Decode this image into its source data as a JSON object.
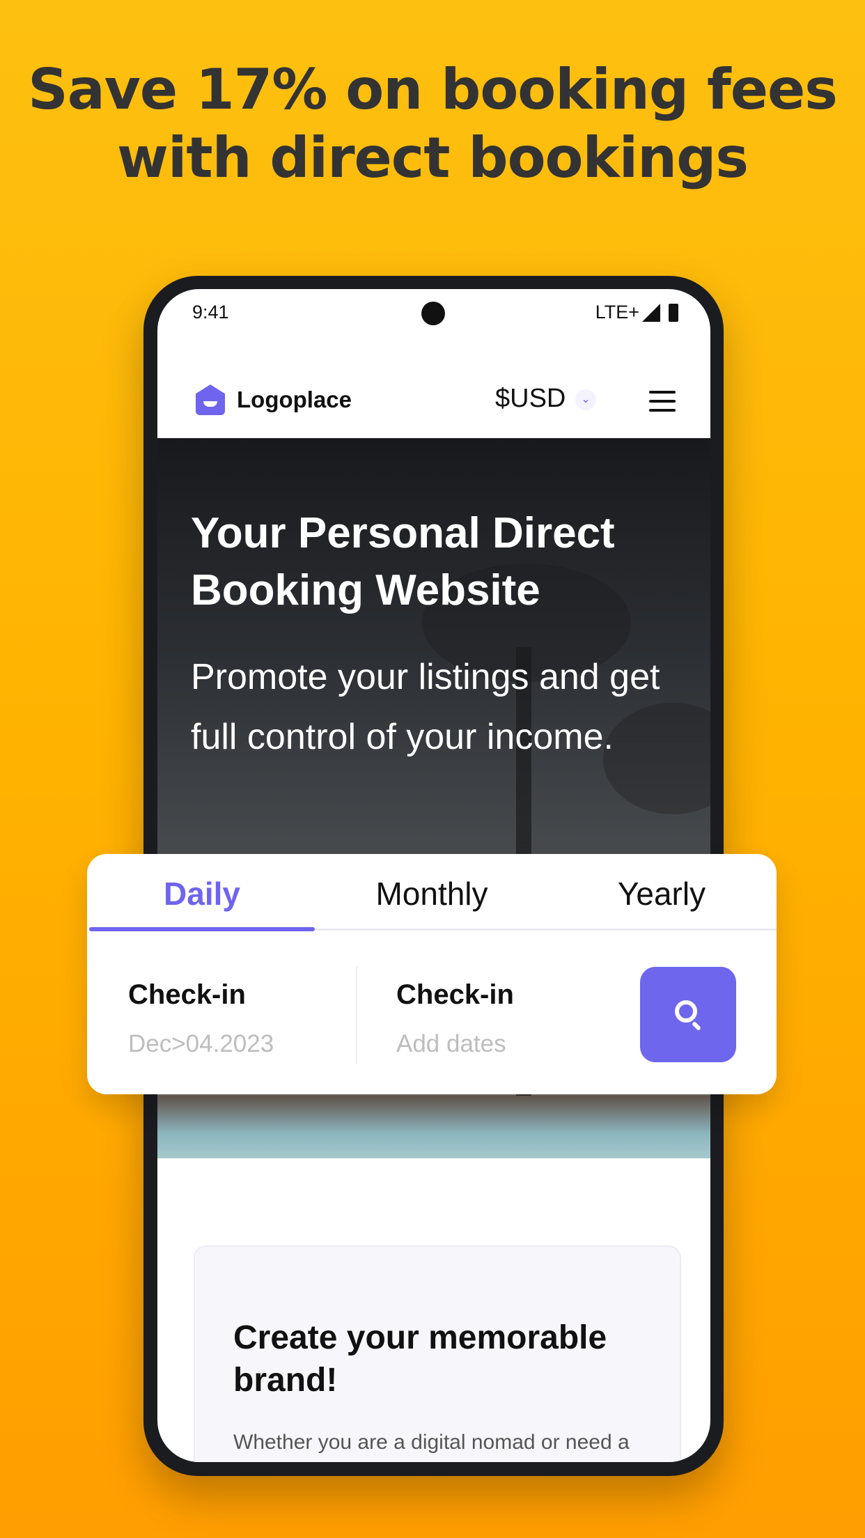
{
  "promo": {
    "headline_line1": "Save 17% on booking fees",
    "headline_line2": "with direct bookings"
  },
  "status_bar": {
    "time": "9:41",
    "network": "LTE+",
    "icons": [
      "signal-icon",
      "battery-charging-icon"
    ]
  },
  "nav": {
    "brand": "Logoplace",
    "currency": "$USD",
    "icons": [
      "logo-house-icon",
      "chevron-down-icon",
      "hamburger-menu-icon"
    ]
  },
  "hero": {
    "title": "Your Personal Direct Booking Website",
    "subtitle": "Promote your listings and get full control of your income."
  },
  "booking": {
    "tabs": [
      {
        "label": "Daily",
        "active": true
      },
      {
        "label": "Monthly",
        "active": false
      },
      {
        "label": "Yearly",
        "active": false
      }
    ],
    "fields": [
      {
        "label": "Check-in",
        "value": "Dec>04.2023"
      },
      {
        "label": "Check-in",
        "value": "Add dates"
      }
    ],
    "search_icon": "search-icon"
  },
  "feature": {
    "title": "Create your memorable brand!",
    "body": "Whether you are a digital nomad or need a"
  },
  "colors": {
    "accent": "#6f64ee",
    "background_top": "#FEC010",
    "background_bottom": "#FF9E00",
    "headline": "#333333"
  }
}
